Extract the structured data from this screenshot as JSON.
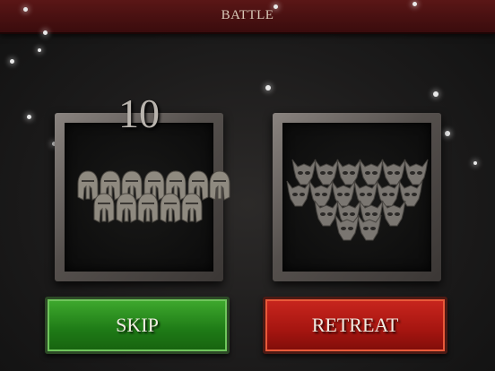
{
  "header": {
    "title": "BATTLE"
  },
  "player_army": {
    "count": "10",
    "unit_icon": "spartan-helmet-icon"
  },
  "enemy_army": {
    "unit_icon": "horned-demon-skull-icon"
  },
  "buttons": {
    "skip_label": "SKIP",
    "retreat_label": "RETREAT"
  },
  "colors": {
    "skip": "#1e7a16",
    "retreat": "#a51510",
    "header": "#4a1111"
  }
}
